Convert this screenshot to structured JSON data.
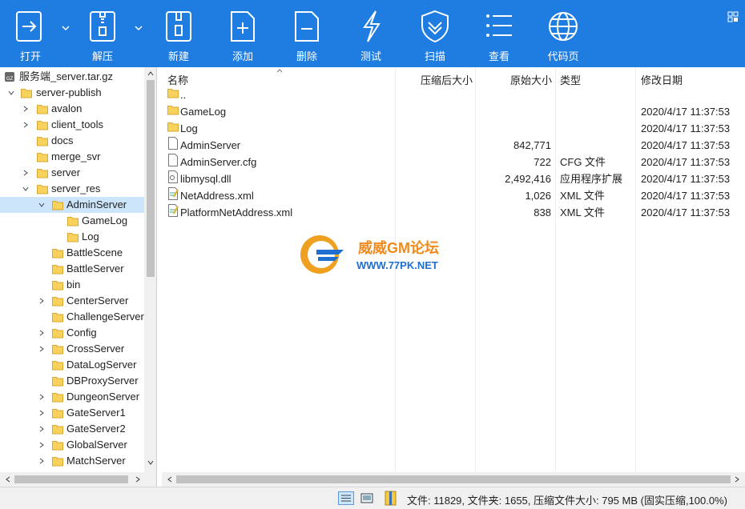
{
  "toolbar": {
    "buttons": [
      {
        "label": "打开",
        "icon": "open-icon"
      },
      {
        "label": "解压",
        "icon": "extract-icon"
      },
      {
        "label": "新建",
        "icon": "new-archive-icon"
      },
      {
        "label": "添加",
        "icon": "add-icon"
      },
      {
        "label": "删除",
        "icon": "delete-icon"
      },
      {
        "label": "测试",
        "icon": "test-icon"
      },
      {
        "label": "扫描",
        "icon": "scan-shield-icon"
      },
      {
        "label": "查看",
        "icon": "view-list-icon"
      },
      {
        "label": "代码页",
        "icon": "globe-icon"
      }
    ],
    "accent": "#1f7ce0"
  },
  "tree": {
    "root": "服务端_server.tar.gz",
    "items": [
      {
        "label": "server-publish"
      },
      {
        "label": "avalon"
      },
      {
        "label": "client_tools"
      },
      {
        "label": "docs"
      },
      {
        "label": "merge_svr"
      },
      {
        "label": "server"
      },
      {
        "label": "server_res"
      },
      {
        "label": "AdminServer"
      },
      {
        "label": "GameLog"
      },
      {
        "label": "Log"
      },
      {
        "label": "BattleScene"
      },
      {
        "label": "BattleServer"
      },
      {
        "label": "bin"
      },
      {
        "label": "CenterServer"
      },
      {
        "label": "ChallengeServer"
      },
      {
        "label": "Config"
      },
      {
        "label": "CrossServer"
      },
      {
        "label": "DataLogServer"
      },
      {
        "label": "DBProxyServer"
      },
      {
        "label": "DungeonServer"
      },
      {
        "label": "GateServer1"
      },
      {
        "label": "GateServer2"
      },
      {
        "label": "GlobalServer"
      },
      {
        "label": "MatchServer"
      }
    ]
  },
  "list": {
    "columns": {
      "name": "名称",
      "compressed": "压缩后大小",
      "original": "原始大小",
      "type": "类型",
      "modified": "修改日期"
    },
    "rows": [
      {
        "name": "..",
        "compressed": "",
        "original": "",
        "type": "",
        "modified": "",
        "icon": "folder-icon"
      },
      {
        "name": "GameLog",
        "compressed": "",
        "original": "",
        "type": "",
        "modified": "2020/4/17 11:37:53",
        "icon": "folder-icon"
      },
      {
        "name": "Log",
        "compressed": "",
        "original": "",
        "type": "",
        "modified": "2020/4/17 11:37:53",
        "icon": "folder-icon"
      },
      {
        "name": "AdminServer",
        "compressed": "",
        "original": "842,771",
        "type": "",
        "modified": "2020/4/17 11:37:53",
        "icon": "file-icon"
      },
      {
        "name": "AdminServer.cfg",
        "compressed": "",
        "original": "722",
        "type": "CFG 文件",
        "modified": "2020/4/17 11:37:53",
        "icon": "file-icon"
      },
      {
        "name": "libmysql.dll",
        "compressed": "",
        "original": "2,492,416",
        "type": "应用程序扩展",
        "modified": "2020/4/17 11:37:53",
        "icon": "dll-file-icon"
      },
      {
        "name": "NetAddress.xml",
        "compressed": "",
        "original": "1,026",
        "type": "XML 文件",
        "modified": "2020/4/17 11:37:53",
        "icon": "xml-file-icon"
      },
      {
        "name": "PlatformNetAddress.xml",
        "compressed": "",
        "original": "838",
        "type": "XML 文件",
        "modified": "2020/4/17 11:37:53",
        "icon": "xml-file-icon"
      }
    ]
  },
  "watermark": {
    "title": "威威GM论坛",
    "url": "WWW.77PK.NET"
  },
  "status": {
    "text": "文件: 11829, 文件夹: 1655, 压缩文件大小: 795 MB (固实压缩,100.0%)"
  }
}
